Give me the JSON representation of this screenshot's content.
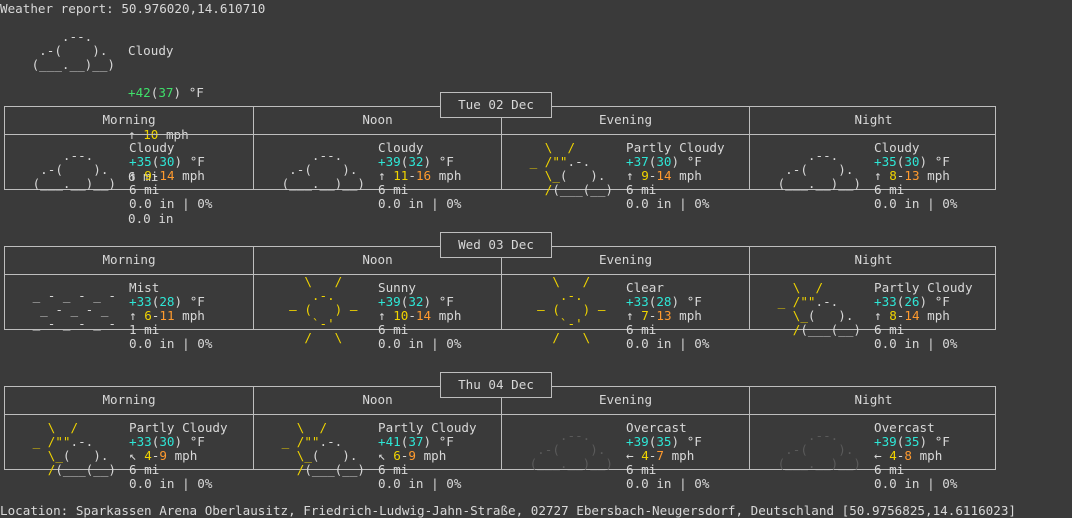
{
  "header": {
    "title": "Weather report: 50.976020,14.610710",
    "current": {
      "condition": "Cloudy",
      "temp": "+42",
      "feels": "37",
      "unit": "°F",
      "wind_arrow": "↑",
      "wind": "10",
      "wind_unit": "mph",
      "visibility": "6 mi",
      "precip": "0.0 in",
      "icon": [
        "     .--.    ",
        "  .-(    ).  ",
        " (___.__)__) "
      ]
    }
  },
  "days": [
    {
      "date": "Tue 02 Dec",
      "periods": [
        {
          "label": "Morning",
          "condition": "Cloudy",
          "temp": "+35",
          "feels": "30",
          "unit": "°F",
          "wind_arrow": "↑",
          "wind_lo": "9",
          "wind_hi": "14",
          "wind_unit": "mph",
          "visibility": "6 mi",
          "precip": "0.0 in | 0%",
          "icon_type": "cloudy",
          "icon": [
            "     .--.    ",
            "  .-(    ).  ",
            " (___.__)__) "
          ]
        },
        {
          "label": "Noon",
          "condition": "Cloudy",
          "temp": "+39",
          "feels": "32",
          "unit": "°F",
          "wind_arrow": "↑",
          "wind_lo": "11",
          "wind_hi": "16",
          "wind_unit": "mph",
          "visibility": "6 mi",
          "precip": "0.0 in | 0%",
          "icon_type": "cloudy",
          "icon": [
            "     .--.    ",
            "  .-(    ).  ",
            " (___.__)__) "
          ]
        },
        {
          "label": "Evening",
          "condition": "Partly Cloudy",
          "temp": "+37",
          "feels": "30",
          "unit": "°F",
          "wind_arrow": "↑",
          "wind_lo": "9",
          "wind_hi": "14",
          "wind_unit": "mph",
          "visibility": "6 mi",
          "precip": "0.0 in | 0%",
          "icon_type": "partly",
          "icon": [
            "   \\  /      ",
            " _ /\"\".-.    ",
            "   \\_(   ).  ",
            "   /(___(__) "
          ]
        },
        {
          "label": "Night",
          "condition": "Cloudy",
          "temp": "+35",
          "feels": "30",
          "unit": "°F",
          "wind_arrow": "↑",
          "wind_lo": "8",
          "wind_hi": "13",
          "wind_unit": "mph",
          "visibility": "6 mi",
          "precip": "0.0 in | 0%",
          "icon_type": "cloudy",
          "icon": [
            "     .--.    ",
            "  .-(    ).  ",
            " (___.__)__) "
          ]
        }
      ]
    },
    {
      "date": "Wed 03 Dec",
      "periods": [
        {
          "label": "Morning",
          "condition": "Mist",
          "temp": "+33",
          "feels": "28",
          "unit": "°F",
          "wind_arrow": "↑",
          "wind_lo": "6",
          "wind_hi": "11",
          "wind_unit": "mph",
          "visibility": "1 mi",
          "precip": "0.0 in | 0%",
          "icon_type": "mist",
          "icon": [
            " _ - _ - _ - ",
            "  _ - _ - _  ",
            " _ - _ - _ - "
          ]
        },
        {
          "label": "Noon",
          "condition": "Sunny",
          "temp": "+39",
          "feels": "32",
          "unit": "°F",
          "wind_arrow": "↑",
          "wind_lo": "10",
          "wind_hi": "14",
          "wind_unit": "mph",
          "visibility": "6 mi",
          "precip": "0.0 in | 0%",
          "icon_type": "sunny",
          "icon": [
            "    \\   /    ",
            "     .-.     ",
            "  ― (   ) ―  ",
            "     `-'     ",
            "    /   \\    "
          ]
        },
        {
          "label": "Evening",
          "condition": "Clear",
          "temp": "+33",
          "feels": "28",
          "unit": "°F",
          "wind_arrow": "↑",
          "wind_lo": "7",
          "wind_hi": "13",
          "wind_unit": "mph",
          "visibility": "6 mi",
          "precip": "0.0 in | 0%",
          "icon_type": "sunny",
          "icon": [
            "    \\   /    ",
            "     .-.     ",
            "  ― (   ) ―  ",
            "     `-'     ",
            "    /   \\    "
          ]
        },
        {
          "label": "Night",
          "condition": "Partly Cloudy",
          "temp": "+33",
          "feels": "26",
          "unit": "°F",
          "wind_arrow": "↑",
          "wind_lo": "8",
          "wind_hi": "14",
          "wind_unit": "mph",
          "visibility": "6 mi",
          "precip": "0.0 in | 0%",
          "icon_type": "partly",
          "icon": [
            "   \\  /      ",
            " _ /\"\".-.    ",
            "   \\_(   ).  ",
            "   /(___(__) "
          ]
        }
      ]
    },
    {
      "date": "Thu 04 Dec",
      "periods": [
        {
          "label": "Morning",
          "condition": "Partly Cloudy",
          "temp": "+33",
          "feels": "30",
          "unit": "°F",
          "wind_arrow": "↖",
          "wind_lo": "4",
          "wind_hi": "9",
          "wind_unit": "mph",
          "visibility": "6 mi",
          "precip": "0.0 in | 0%",
          "icon_type": "partly",
          "icon": [
            "   \\  /      ",
            " _ /\"\".-.    ",
            "   \\_(   ).  ",
            "   /(___(__) "
          ]
        },
        {
          "label": "Noon",
          "condition": "Partly Cloudy",
          "temp": "+41",
          "feels": "37",
          "unit": "°F",
          "wind_arrow": "↖",
          "wind_lo": "6",
          "wind_hi": "9",
          "wind_unit": "mph",
          "visibility": "6 mi",
          "precip": "0.0 in | 0%",
          "icon_type": "partly",
          "icon": [
            "   \\  /      ",
            " _ /\"\".-.    ",
            "   \\_(   ).  ",
            "   /(___(__) "
          ]
        },
        {
          "label": "Evening",
          "condition": "Overcast",
          "temp": "+39",
          "feels": "35",
          "unit": "°F",
          "wind_arrow": "←",
          "wind_lo": "4",
          "wind_hi": "7",
          "wind_unit": "mph",
          "visibility": "6 mi",
          "precip": "0.0 in | 0%",
          "icon_type": "overcast",
          "icon": [
            "     .--.    ",
            "  .-(    ).  ",
            " (___.__)__) "
          ]
        },
        {
          "label": "Night",
          "condition": "Overcast",
          "temp": "+39",
          "feels": "35",
          "unit": "°F",
          "wind_arrow": "←",
          "wind_lo": "4",
          "wind_hi": "8",
          "wind_unit": "mph",
          "visibility": "6 mi",
          "precip": "0.0 in | 0%",
          "icon_type": "overcast",
          "icon": [
            "     .--.    ",
            "  .-(    ).  ",
            " (___.__)__) "
          ]
        }
      ]
    }
  ],
  "footer": {
    "location": "Location: Sparkassen Arena Oberlausitz, Friedrich-Ludwig-Jahn-Straße, 02727 Ebersbach-Neugersdorf, Deutschland [50.9756825,14.6116023]"
  },
  "colors": {
    "background": "#3a3a3a",
    "text": "#d8d8d8",
    "sun_yellow": "#f0d400",
    "wind_orange": "#ff9a2e",
    "temp_cyan": "#2ee6d6",
    "temp_green": "#3fe06a",
    "overcast_gray": "#5a5a5a"
  }
}
